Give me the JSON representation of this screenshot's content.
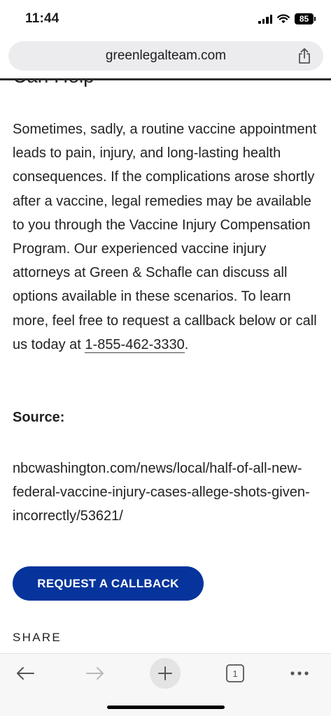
{
  "status_bar": {
    "time": "11:44",
    "battery_level": "85"
  },
  "address_bar": {
    "url": "greenlegalteam.com"
  },
  "article": {
    "cut_heading": "Can Help",
    "body_text": "Sometimes, sadly, a routine vaccine appointment leads to pain, injury, and long-lasting health consequences. If the complications arose shortly after a vaccine, legal remedies may be available to you through the Vaccine Injury Compensation Program. Our experienced vaccine injury attorneys at Green & Schafle can discuss all options available in these scenarios. To learn more, feel free to request a callback below or call us today at ",
    "phone": "1-855-462-3330",
    "trailing": ".",
    "source_label": "Source:",
    "source_url": "nbcwashington.com/news/local/half-of-all-new-federal-vaccine-injury-cases-allege-shots-given-incorrectly/53621/",
    "callback_label": "REQUEST A CALLBACK",
    "share_label": "SHARE"
  },
  "toolbar": {
    "tab_count": "1",
    "icons": [
      "back-arrow-icon",
      "forward-arrow-icon",
      "plus-icon",
      "tabs-icon",
      "more-dots-icon"
    ]
  },
  "colors": {
    "accent": "#06349c",
    "text": "#222222",
    "address_bg": "#ececee"
  }
}
